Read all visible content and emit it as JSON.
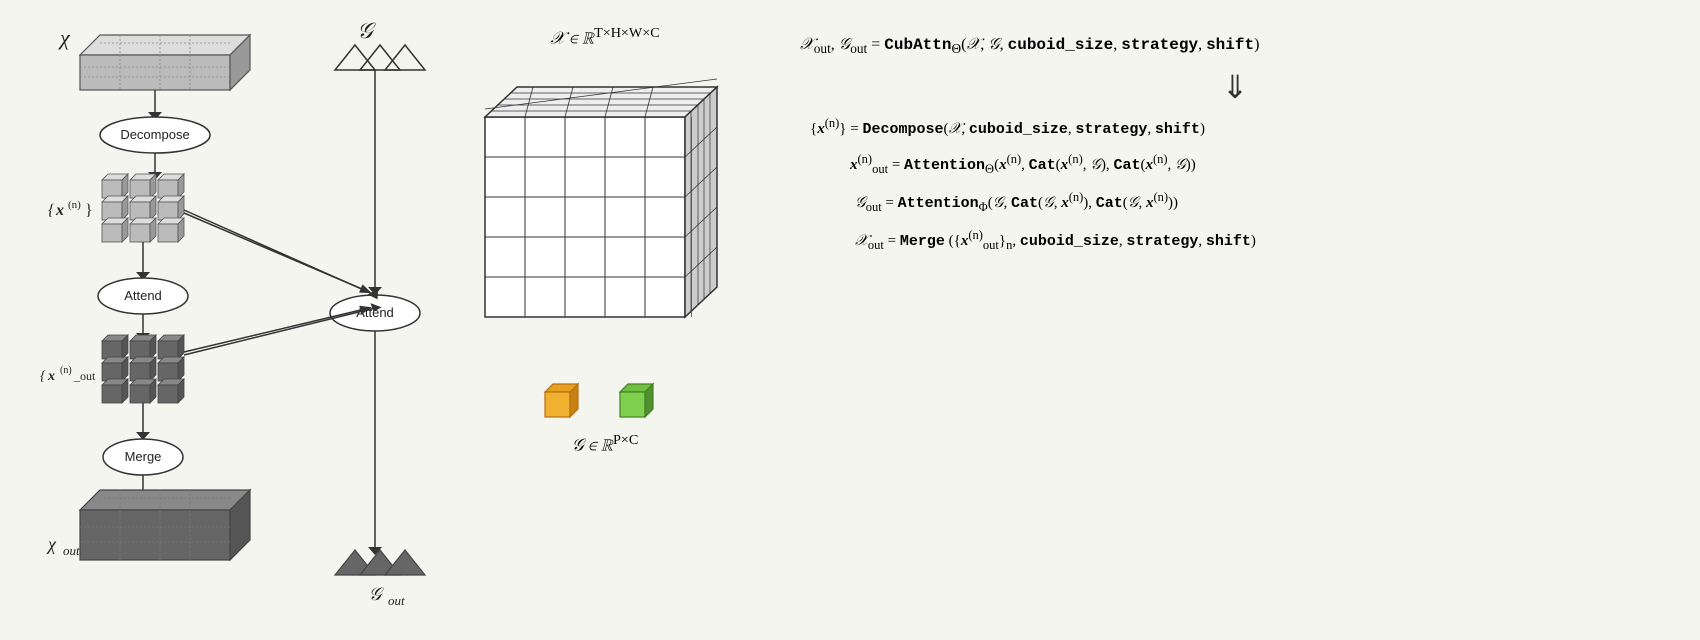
{
  "left_panel": {
    "chi_label": "χ",
    "decompose_label": "Decompose",
    "x_n_label": "{x⁽ⁿ⁾}",
    "attend_label": "Attend",
    "x_out_n_label": "{x⁽ⁿ⁾_out}",
    "merge_label": "Merge",
    "chi_out_label": "χ_out"
  },
  "middle_panel": {
    "g_label": "𝒢",
    "attend_label": "Attend",
    "g_out_label": "𝒢_out"
  },
  "center_panel": {
    "formula_top": "𝒳 ∈ ℝ^{T×H×W×C}",
    "formula_bottom": "𝒢 ∈ ℝ^{P×C}"
  },
  "right_panel": {
    "eq1": "𝒳_out, 𝒢_out = CubAttn_Θ(𝒳, 𝒢, cuboid_size, strategy, shift)",
    "eq2": "{x⁽ⁿ⁾} = Decompose(𝒳, cuboid_size, strategy, shift)",
    "eq3": "x⁽ⁿ⁾_out = Attention_Θ(x⁽ⁿ⁾, Cat(x⁽ⁿ⁾, 𝒢), Cat(x⁽ⁿ⁾, 𝒢))",
    "eq4": "𝒢_out = Attention_Φ(𝒢, Cat(𝒢, x⁽ⁿ⁾), Cat(𝒢, x⁽ⁿ⁾))",
    "eq5": "𝒳_out = Merge ({x⁽ⁿ⁾_out}_n , cuboid_size, strategy, shift)"
  }
}
